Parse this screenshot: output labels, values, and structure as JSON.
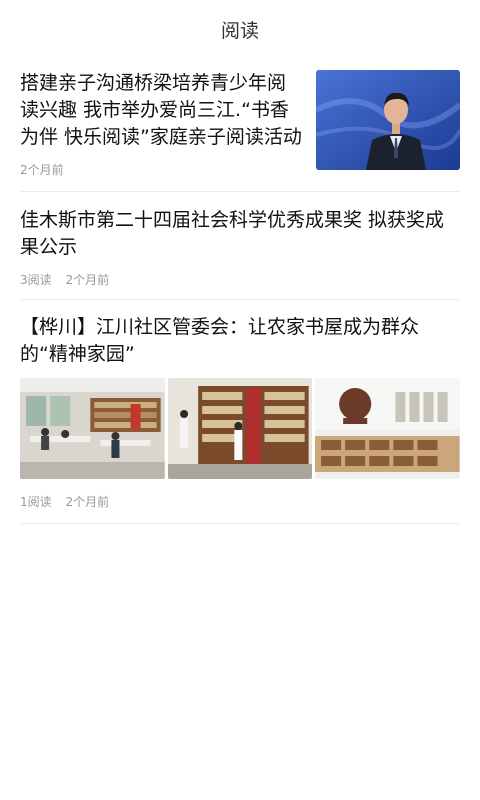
{
  "header": {
    "title": "阅读"
  },
  "articles": [
    {
      "title": "搭建亲子沟通桥梁培养青少年阅读兴趣 我市举办爱尚三江.“书香为伴 快乐阅读”家庭亲子阅读活动",
      "time": "2个月前"
    },
    {
      "title": "佳木斯市第二十四届社会科学优秀成果奖 拟获奖成果公示",
      "reads": "3阅读",
      "time": "2个月前"
    },
    {
      "title": "【桦川】江川社区管委会：让农家书屋成为群众的“精神家园”",
      "reads": "1阅读",
      "time": "2个月前"
    }
  ]
}
